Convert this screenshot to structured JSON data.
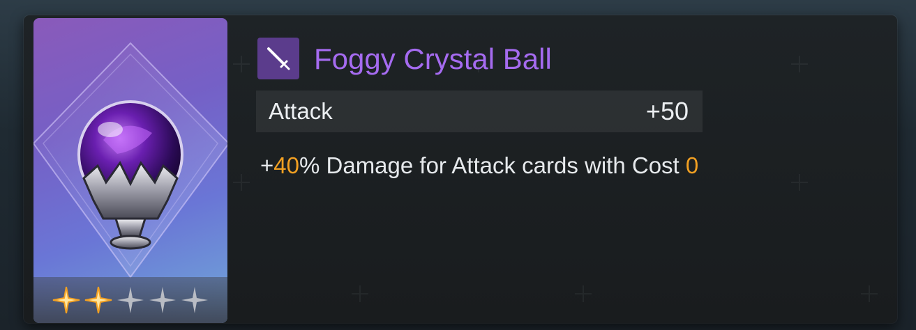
{
  "item": {
    "name": "Foggy Crystal Ball",
    "type_icon": "sword-icon",
    "image": "crystal-ball",
    "rarity": {
      "filled": 2,
      "total": 5
    }
  },
  "stats": [
    {
      "label": "Attack",
      "value": "+50"
    }
  ],
  "effect": {
    "prefix": "+",
    "amount": "40",
    "middle": "% Damage for Attack cards with Cost ",
    "cost": "0"
  },
  "colors": {
    "title": "#a56bf0",
    "highlight": "#f2a022",
    "badge": "#5b3c8c",
    "star_filled": "#ffe6a0",
    "star_empty": "#b9bcc4"
  }
}
